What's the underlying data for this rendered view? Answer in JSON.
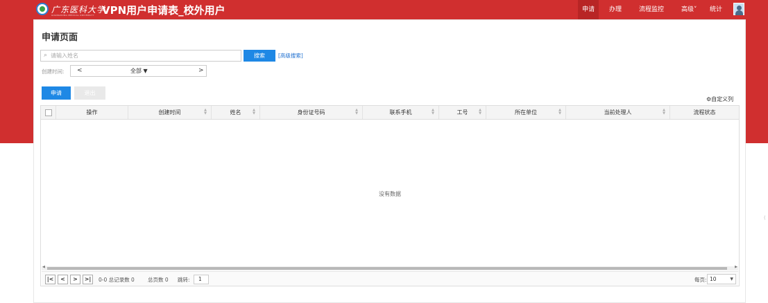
{
  "header": {
    "logo_text": "广东医科大学",
    "logo_sub": "GUANGDONG MEDICAL UNIVERSITY",
    "app_title": "VPN用户申请表_校外用户",
    "nav": [
      {
        "label": "申请"
      },
      {
        "label": "办理"
      },
      {
        "label": "流程监控"
      },
      {
        "label": "高级˅"
      },
      {
        "label": "统计"
      }
    ]
  },
  "page": {
    "title": "申请页面"
  },
  "search": {
    "placeholder": "请输入姓名",
    "button": "搜索",
    "advanced": "[高级搜索]"
  },
  "date_filter": {
    "label": "创建时间:",
    "prev": "<",
    "value": "全部 ▼",
    "next": ">"
  },
  "actions": {
    "apply": "申请",
    "exit": "退出",
    "custom_columns": "自定义列"
  },
  "table": {
    "columns": [
      "操作",
      "创建时间",
      "姓名",
      "身份证号码",
      "联系手机",
      "工号",
      "所在单位",
      "当前处理人",
      "流程状态"
    ],
    "empty_text": "没有数据"
  },
  "pager": {
    "first": "|<",
    "prev": "<",
    "next": ">",
    "last": ">|",
    "range": "0-0 总记录数 0",
    "total_pages": "总页数 0",
    "jump_label": "跳转:",
    "jump_value": "1",
    "per_page_label": "每页:",
    "per_page_value": "10"
  },
  "colors": {
    "brand_red": "#d02f2f",
    "primary_blue": "#1e88e5"
  }
}
